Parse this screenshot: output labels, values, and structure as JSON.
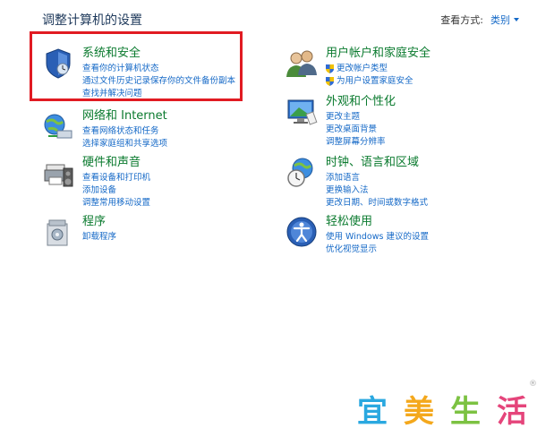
{
  "header": {
    "title": "调整计算机的设置",
    "view_by_label": "查看方式:",
    "view_by_value": "类别"
  },
  "categories": {
    "security": {
      "title": "系统和安全",
      "links": [
        "查看你的计算机状态",
        "通过文件历史记录保存你的文件备份副本",
        "查找并解决问题"
      ]
    },
    "network": {
      "title": "网络和 Internet",
      "links": [
        "查看网络状态和任务",
        "选择家庭组和共享选项"
      ]
    },
    "hardware": {
      "title": "硬件和声音",
      "links": [
        "查看设备和打印机",
        "添加设备",
        "调整常用移动设置"
      ]
    },
    "programs": {
      "title": "程序",
      "links": [
        "卸载程序"
      ]
    },
    "users": {
      "title": "用户帐户和家庭安全",
      "links": [
        "更改帐户类型",
        "为用户设置家庭安全"
      ]
    },
    "appearance": {
      "title": "外观和个性化",
      "links": [
        "更改主题",
        "更改桌面背景",
        "调整屏幕分辨率"
      ]
    },
    "clock": {
      "title": "时钟、语言和区域",
      "links": [
        "添加语言",
        "更换输入法",
        "更改日期、时间或数字格式"
      ]
    },
    "ease": {
      "title": "轻松使用",
      "links": [
        "使用 Windows 建议的设置",
        "优化视觉显示"
      ]
    }
  },
  "watermark": {
    "chars": [
      "宜",
      "美",
      "生",
      "活"
    ],
    "mark": "®"
  }
}
